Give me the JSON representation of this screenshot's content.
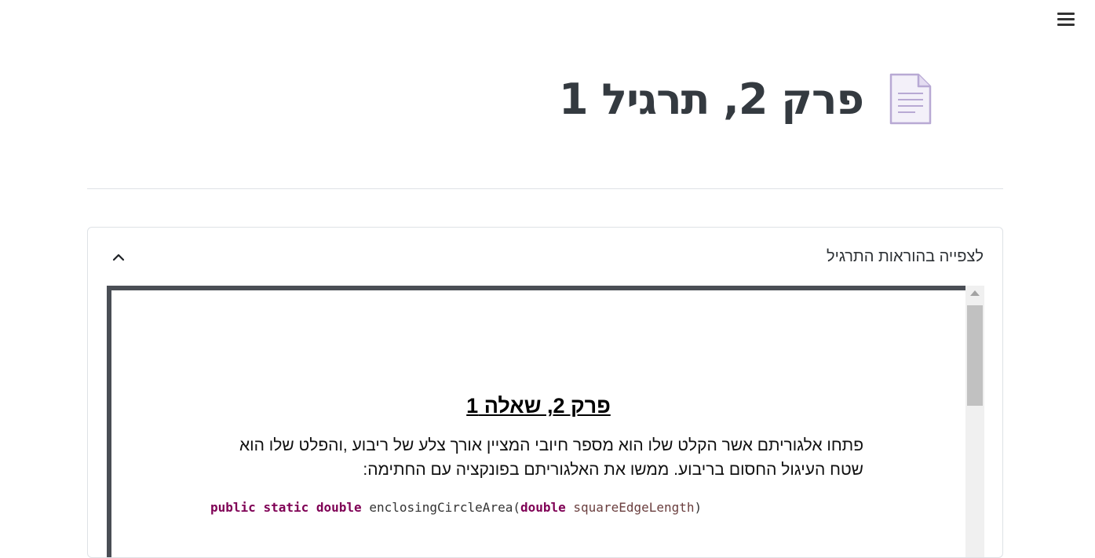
{
  "header": {
    "menu_icon": "hamburger-menu-icon",
    "page_icon": "document-icon",
    "title": "פרק 2, תרגיל 1"
  },
  "instructions": {
    "toggle_label": "לצפייה בהוראות התרגיל",
    "toggle_icon": "chevron-up-icon",
    "document": {
      "title": "פרק 2, שאלה 1",
      "body": "פתחו אלגוריתם אשר הקלט שלו הוא מספר חיובי המציין אורך צלע של ריבוע ,והפלט שלו הוא שטח העיגול החסום בריבוע. ממשו את האלגוריתם בפונקציה עם החתימה:",
      "code": {
        "kw1": "public",
        "kw2": "static",
        "kw3": "double",
        "method": "enclosingCircleArea(",
        "param_type": "double",
        "param_name": "squareEdgeLength",
        "close": ")"
      }
    }
  },
  "colors": {
    "keyword": "#7f0055",
    "frame_border": "#4a4e55",
    "icon_purple": "#b8a9d4"
  }
}
